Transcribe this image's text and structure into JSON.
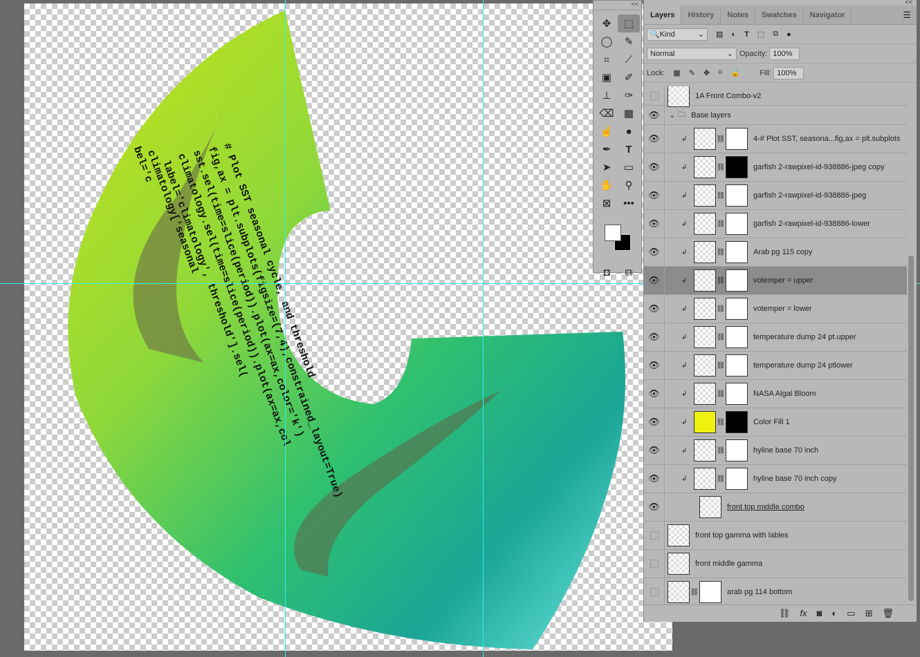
{
  "canvas": {
    "artwork_code_lines": [
      "# Plot SST seasonal cycle, and threshold",
      "fig,ax = plt.subplots(figsize=(7,4),constrained_layout=True)",
      "sst.sel(time=slice(period)).plot(ax=ax,color='k')",
      "climatology.sel(time=slice(period)).plot(ax=ax,col",
      "label='climatology', threshold'].sel(",
      "climatology['seasonal",
      "bel='c"
    ],
    "guide_color": "#2ff0f0"
  },
  "toolbar": {
    "collapse": "<<",
    "tools": [
      "move-icon",
      "marquee-icon",
      "lasso-icon",
      "quick-select-icon",
      "crop-icon",
      "eyedropper-icon",
      "frame-icon",
      "brush-icon",
      "stamp-icon",
      "history-brush-icon",
      "eraser-icon",
      "gradient-icon",
      "smudge-icon",
      "dodge-icon",
      "pen-icon",
      "type-icon",
      "path-select-icon",
      "rectangle-icon",
      "hand-icon",
      "zoom-icon",
      "artboard-icon",
      "more-icon"
    ],
    "fg_color": "#ffffff",
    "bg_color": "#000000"
  },
  "panel": {
    "collapse": "<<",
    "tabs": [
      "Layers",
      "History",
      "Notes",
      "Swatches",
      "Navigator"
    ],
    "active_tab": "Layers",
    "filter": {
      "kind": "Kind"
    },
    "blend_mode": "Normal",
    "opacity_label": "Opacity:",
    "opacity": "100%",
    "lock_label": "Lock:",
    "fill_label": "Fill:",
    "fill": "100%",
    "layers": [
      {
        "name": "1A Front Combo-v2",
        "visible": false,
        "type": "top"
      },
      {
        "name": "Base layers",
        "visible": true,
        "type": "group"
      },
      {
        "name": "4-# Plot SST, seasona...fig,ax = plt.subplots",
        "visible": true,
        "type": "clip",
        "mask": "white"
      },
      {
        "name": "garfish 2-rawpixel-id-938886-jpeg copy",
        "visible": true,
        "type": "clip",
        "mask": "black"
      },
      {
        "name": "garfish 2-rawpixel-id-938886-jpeg",
        "visible": true,
        "type": "clip",
        "mask": "white"
      },
      {
        "name": "garfish 2-rawpixel-id-938886-lower",
        "visible": true,
        "type": "clip",
        "mask": "white"
      },
      {
        "name": "Arab pg 115 copy",
        "visible": true,
        "type": "clip",
        "mask": "white"
      },
      {
        "name": "votemper =      upper",
        "visible": true,
        "type": "clip",
        "mask": "white",
        "selected": true
      },
      {
        "name": "votemper =    lower",
        "visible": true,
        "type": "clip",
        "mask": "white"
      },
      {
        "name": "temperature dump 24 pt.upper",
        "visible": true,
        "type": "clip",
        "mask": "white"
      },
      {
        "name": "temperature dump 24 ptlower",
        "visible": true,
        "type": "clip",
        "mask": "white"
      },
      {
        "name": "NASA Algal Bloom",
        "visible": true,
        "type": "clip",
        "mask": "white"
      },
      {
        "name": "Color Fill 1",
        "visible": true,
        "type": "clip",
        "mask": "black",
        "fill": "#eef20e"
      },
      {
        "name": "hyline base 70 inch",
        "visible": true,
        "type": "clip",
        "mask": "white"
      },
      {
        "name": "hyline base 70 inch copy",
        "visible": true,
        "type": "clip",
        "mask": "white"
      },
      {
        "name": "front top middle combo",
        "visible": true,
        "type": "base"
      },
      {
        "name": "front top gamma with lables",
        "visible": false,
        "type": "plain"
      },
      {
        "name": "front middle gamma",
        "visible": false,
        "type": "plain"
      },
      {
        "name": "arab pg 114 bottom",
        "visible": false,
        "type": "masked"
      }
    ],
    "bottom_icons": [
      "link-icon",
      "fx-icon",
      "add-mask-icon",
      "adjustment-icon",
      "new-group-icon",
      "new-layer-icon",
      "trash-icon"
    ]
  }
}
